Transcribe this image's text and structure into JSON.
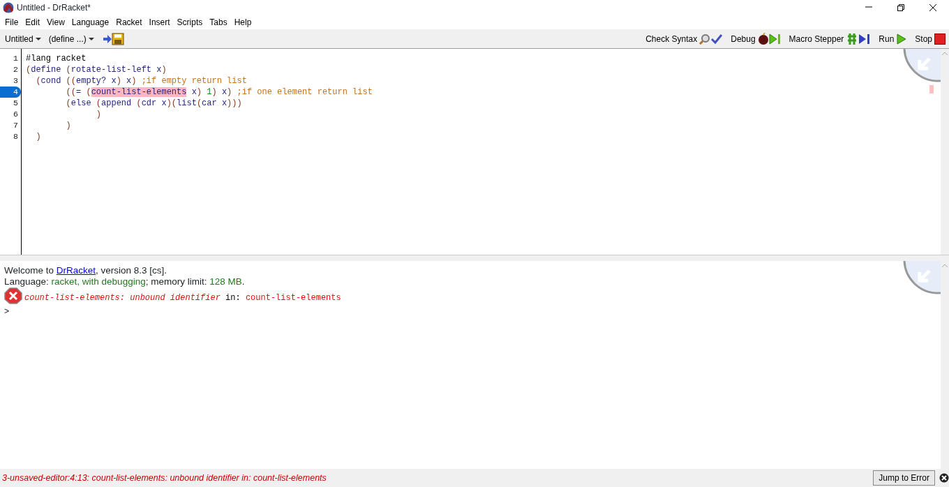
{
  "window": {
    "title": "Untitled - DrRacket*"
  },
  "menu": [
    "File",
    "Edit",
    "View",
    "Language",
    "Racket",
    "Insert",
    "Scripts",
    "Tabs",
    "Help"
  ],
  "toolbar": {
    "file_menu": "Untitled",
    "define_menu": "(define ...)",
    "buttons": [
      {
        "label": "Check Syntax",
        "kind": "check"
      },
      {
        "label": "Debug",
        "kind": "debug"
      },
      {
        "label": "Macro Stepper",
        "kind": "macro"
      },
      {
        "label": "Run",
        "kind": "run"
      },
      {
        "label": "Stop",
        "kind": "stop"
      }
    ]
  },
  "editor": {
    "lines": [
      {
        "number": "1",
        "marked": false,
        "segments": [
          {
            "text": "#lang racket",
            "kind": "plain"
          }
        ]
      },
      {
        "number": "2",
        "marked": false,
        "segments": [
          {
            "text": "(",
            "kind": "paren"
          },
          {
            "text": "define",
            "kind": "sym"
          },
          {
            "text": " (",
            "kind": "paren"
          },
          {
            "text": "rotate-list-left x",
            "kind": "sym"
          },
          {
            "text": ")",
            "kind": "paren"
          }
        ]
      },
      {
        "number": "3",
        "marked": false,
        "segments": [
          {
            "text": "  (",
            "kind": "paren"
          },
          {
            "text": "cond",
            "kind": "sym"
          },
          {
            "text": " ((",
            "kind": "paren"
          },
          {
            "text": "empty? x",
            "kind": "sym"
          },
          {
            "text": ") ",
            "kind": "paren"
          },
          {
            "text": "x",
            "kind": "sym"
          },
          {
            "text": ") ",
            "kind": "paren"
          },
          {
            "text": ";if empty return list",
            "kind": "comment"
          }
        ]
      },
      {
        "number": "4",
        "marked": true,
        "segments": [
          {
            "text": "        ((",
            "kind": "paren"
          },
          {
            "text": "=",
            "kind": "sym"
          },
          {
            "text": " (",
            "kind": "paren"
          },
          {
            "text": "count-list-elements",
            "kind": "error"
          },
          {
            "text": " x",
            "kind": "sym"
          },
          {
            "text": ") ",
            "kind": "paren"
          },
          {
            "text": "1",
            "kind": "num"
          },
          {
            "text": ") ",
            "kind": "paren"
          },
          {
            "text": "x",
            "kind": "sym"
          },
          {
            "text": ") ",
            "kind": "paren"
          },
          {
            "text": ";if one element return list",
            "kind": "comment"
          }
        ]
      },
      {
        "number": "5",
        "marked": false,
        "segments": [
          {
            "text": "        (",
            "kind": "paren"
          },
          {
            "text": "else",
            "kind": "sym"
          },
          {
            "text": " (",
            "kind": "paren"
          },
          {
            "text": "append",
            "kind": "sym"
          },
          {
            "text": " (",
            "kind": "paren"
          },
          {
            "text": "cdr x",
            "kind": "sym"
          },
          {
            "text": ")(",
            "kind": "paren"
          },
          {
            "text": "list",
            "kind": "sym"
          },
          {
            "text": "(",
            "kind": "paren"
          },
          {
            "text": "car x",
            "kind": "sym"
          },
          {
            "text": ")))",
            "kind": "paren"
          }
        ]
      },
      {
        "number": "6",
        "marked": false,
        "segments": [
          {
            "text": "              )",
            "kind": "paren"
          }
        ]
      },
      {
        "number": "7",
        "marked": false,
        "segments": [
          {
            "text": "        )",
            "kind": "paren"
          }
        ]
      },
      {
        "number": "8",
        "marked": false,
        "segments": [
          {
            "text": "  )",
            "kind": "paren"
          }
        ]
      }
    ]
  },
  "interactions": {
    "welcome": {
      "before": "Welcome to ",
      "link": "DrRacket",
      "after": ", version 8.3 [cs]."
    },
    "language": [
      {
        "text": "Language: ",
        "kind": "plain"
      },
      {
        "text": "racket, with debugging",
        "kind": "value"
      },
      {
        "text": "; memory limit: ",
        "kind": "plain"
      },
      {
        "text": "128 MB",
        "kind": "value"
      },
      {
        "text": ".",
        "kind": "plain"
      }
    ],
    "error": [
      {
        "text": "count-list-elements: unbound identifier",
        "kind": "err"
      },
      {
        "text": " in: ",
        "kind": "plain"
      },
      {
        "text": "count-list-elements",
        "kind": "errplain"
      }
    ],
    "prompt": ">"
  },
  "status_bar": {
    "message": "3-unsaved-editor:4:13: count-list-elements: unbound identifier in: count-list-elements",
    "button": "Jump to Error"
  }
}
